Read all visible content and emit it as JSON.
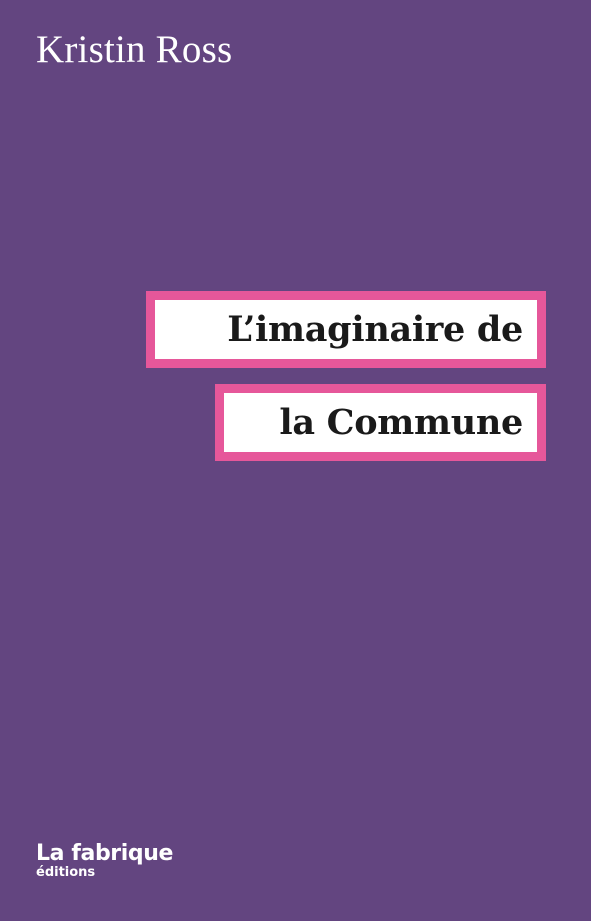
{
  "cover": {
    "background_color": "#634580",
    "accent_color": "#e6579a",
    "author": "Kristin Ross",
    "title_lines": [
      "L’imaginaire de",
      "la Commune"
    ],
    "publisher": {
      "name": "La fabrique",
      "subtitle": "éditions"
    }
  }
}
